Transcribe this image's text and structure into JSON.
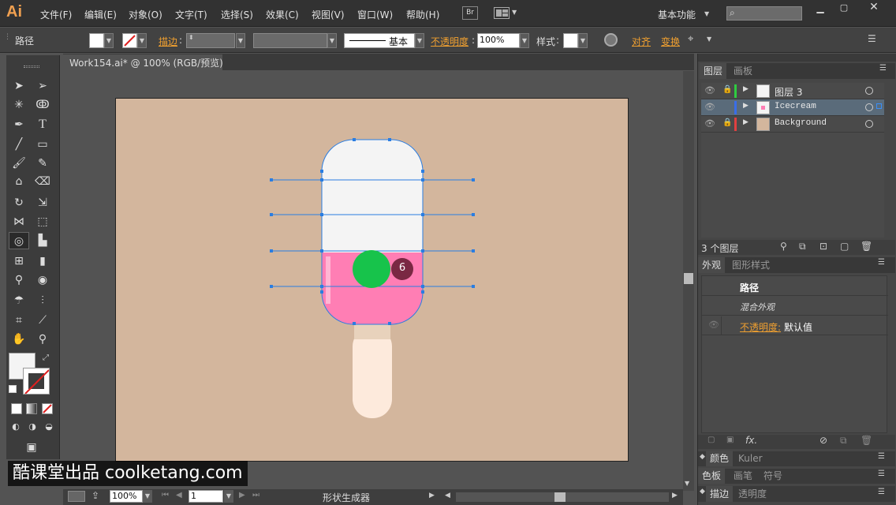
{
  "menubar": {
    "logo": "Ai",
    "items": [
      "文件(F)",
      "编辑(E)",
      "对象(O)",
      "文字(T)",
      "选择(S)",
      "效果(C)",
      "视图(V)",
      "窗口(W)",
      "帮助(H)"
    ],
    "bridge": "Br",
    "workspace": "基本功能"
  },
  "control": {
    "path_label": "路径",
    "stroke_label": "描边",
    "stroke_style": "基本",
    "opacity_label": "不透明度",
    "opacity_value": "100%",
    "style_label": "样式",
    "align_label": "对齐",
    "transform_label": "变换"
  },
  "document": {
    "tab_title": "Work154.ai* @ 100% (RGB/预览)"
  },
  "canvas": {
    "badge_number": "6",
    "colors": {
      "artboard": "#d3b69d",
      "cream": "#f4f4f4",
      "pink": "#ff7eb4",
      "stick": "#fdeadc",
      "green": "#17c34b",
      "badge": "#7a2843",
      "selection": "#2a7de1"
    }
  },
  "layers_panel": {
    "tab_layers": "图层",
    "tab_artboards": "画板",
    "rows": [
      {
        "name": "图层 3",
        "color": "#2ecc40",
        "locked": true
      },
      {
        "name": "Icecream",
        "color": "#3a6ee8",
        "locked": false
      },
      {
        "name": "Background",
        "color": "#e04040",
        "locked": true
      }
    ],
    "count": "3 个图层"
  },
  "appearance_panel": {
    "tab_appearance": "外观",
    "tab_graphic_styles": "图形样式",
    "title": "路径",
    "mixed": "混合外观",
    "opacity_label": "不透明度:",
    "opacity_value": "默认值",
    "fx": "fx."
  },
  "bottom_panels": {
    "color": "颜色",
    "kuler": "Kuler",
    "swatches": "色板",
    "brushes": "画笔",
    "symbols": "符号",
    "stroke": "描边",
    "transparency": "透明度"
  },
  "status": {
    "zoom": "100%",
    "page": "1",
    "tool_name": "形状生成器"
  },
  "watermark": "酷课堂出品 coolketang.com"
}
